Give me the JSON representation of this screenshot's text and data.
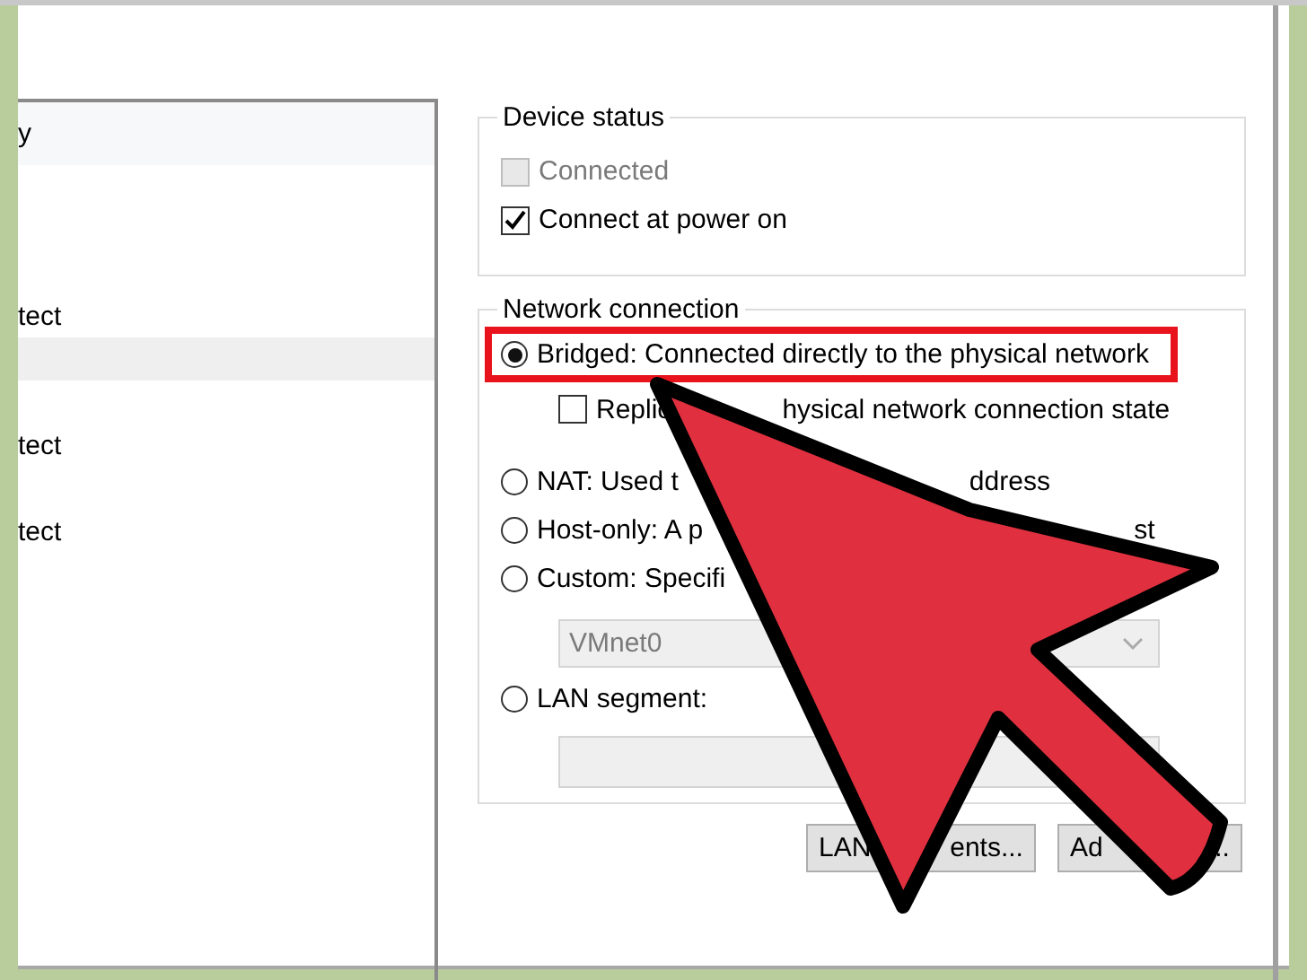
{
  "device_list": {
    "header": "y",
    "items": [
      {
        "label": "tect",
        "selected": false
      },
      {
        "selected": true
      },
      {
        "label": "tect",
        "selected": false
      },
      {
        "label": "tect",
        "selected": false
      }
    ]
  },
  "device_status": {
    "title": "Device status",
    "checkboxes": [
      {
        "label": "Connected",
        "checked": false,
        "disabled": true
      },
      {
        "label": "Connect at power on",
        "checked": true,
        "disabled": false
      }
    ]
  },
  "network_connection": {
    "title": "Network connection",
    "options": [
      {
        "kind": "radio",
        "label": "Bridged: Connected directly to the physical network",
        "selected": true,
        "highlighted": true
      },
      {
        "kind": "checkbox",
        "label": "Replic",
        "label_end": "hysical network connection state",
        "checked": false
      },
      {
        "kind": "radio",
        "label": "NAT: Used t",
        "label_end": "ddress",
        "selected": false
      },
      {
        "kind": "radio",
        "label": "Host-only: A p",
        "label_end": "st",
        "selected": false
      },
      {
        "kind": "radio",
        "label": "Custom: Specifi",
        "selected": false
      },
      {
        "kind": "dropdown",
        "value": "VMnet0",
        "disabled": true
      },
      {
        "kind": "radio",
        "label": "LAN segment:",
        "selected": false
      },
      {
        "kind": "field",
        "disabled": true
      }
    ]
  },
  "buttons": [
    {
      "label": "LAN",
      "label_end": "ents..."
    },
    {
      "label": "Ad",
      "label_end": ".."
    }
  ]
}
